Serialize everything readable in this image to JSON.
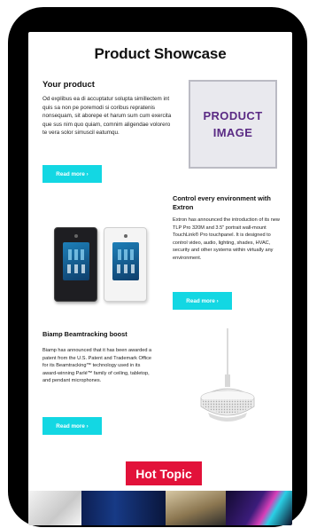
{
  "page": {
    "title": "Product Showcase"
  },
  "sections": [
    {
      "heading": "Your product",
      "body": "Od explibus ea di accuptatur solupta simillectem int quis sa non pe poremodi si coribus repratenis nonsequam, sit aborepe et harum sum cum exercita que sus nim quo quiam, comnim aligendae volorero te vera solor simuscil eatumqu.",
      "button": "Read more ›",
      "image_placeholder": "PRODUCT IMAGE"
    },
    {
      "heading": "Control every environment with Extron",
      "body": "Extron has announced the introduction of its new TLP Pro 320M and 3.5\" portrait wall-mount TouchLink® Pro touchpanel. It is designed to control video, audio, lighting, shades, HVAC, security and other systems within virtually any environment.",
      "button": "Read more ›",
      "image": "touchpanels-image"
    },
    {
      "heading": "Biamp Beamtracking boost",
      "body": "Biamp has announced that it has been awarded a patent from the U.S. Patent and Trademark Office for its Beamtracking™ technology used in its award-winning Parlé™ family of ceiling, tabletop, and pendant microphones.",
      "button": "Read more ›",
      "image": "pendant-microphone-image"
    }
  ],
  "hot_topic": {
    "label": "Hot Topic"
  },
  "colors": {
    "accent": "#13d7e3",
    "hot": "#e2123a",
    "placeholder_text": "#5a2a84"
  }
}
